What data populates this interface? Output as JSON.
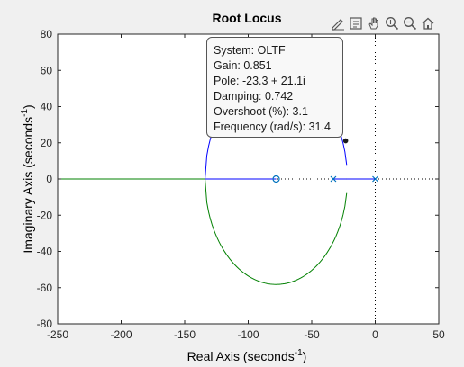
{
  "window": {
    "toolbar": [
      {
        "icon": "annotate-edit-icon"
      },
      {
        "icon": "data-tips-icon"
      },
      {
        "icon": "pan-hand-icon"
      },
      {
        "icon": "zoom-in-icon"
      },
      {
        "icon": "zoom-out-icon"
      },
      {
        "icon": "restore-home-icon"
      }
    ]
  },
  "chart_data": {
    "type": "line",
    "title": "Root Locus",
    "xlabel": "Real Axis (seconds",
    "xlabel_sup": "-1",
    "xlabel_end": ")",
    "ylabel": "Imaginary Axis (seconds",
    "ylabel_sup": "-1",
    "ylabel_end": ")",
    "xlim": [
      -250,
      50
    ],
    "ylim": [
      -80,
      80
    ],
    "xticks": [
      "-250",
      "-200",
      "-150",
      "-100",
      "-50",
      "0",
      "50"
    ],
    "yticks": [
      "80",
      "60",
      "40",
      "20",
      "0",
      "-20",
      "-40",
      "-60",
      "-80"
    ],
    "grid": false,
    "poles": [
      [
        -33,
        0
      ],
      [
        0,
        0
      ]
    ],
    "zeros": [
      [
        -78,
        0
      ]
    ],
    "breakaway_points": [
      [
        -22.5,
        0
      ],
      [
        -134,
        0
      ]
    ],
    "loop_center": [
      -78,
      0
    ],
    "loop_radius": 56,
    "series": [
      {
        "color": "#0000ff",
        "segments": [
          {
            "kind": "real",
            "x": [
              -33,
              -22.5
            ]
          },
          {
            "kind": "arc_upper",
            "from_x": -22.5,
            "to_x": -134
          }
        ]
      },
      {
        "color": "#008000",
        "segments": [
          {
            "kind": "real",
            "x": [
              -250,
              -134
            ]
          },
          {
            "kind": "arc_lower",
            "from_x": -134,
            "to_x": -22.5
          }
        ]
      },
      {
        "color": "#0000ff",
        "segments": [
          {
            "kind": "real",
            "x": [
              -22.5,
              0
            ]
          },
          {
            "kind": "real",
            "x": [
              -78,
              -134
            ]
          }
        ]
      }
    ],
    "selected_point": [
      -23.3,
      21.1
    ],
    "datatip": {
      "system": "System: OLTF",
      "gain": "Gain: 0.851",
      "pole": "Pole: -23.3 + 21.1i",
      "damping": "Damping: 0.742",
      "overshoot": "Overshoot (%): 3.1",
      "frequency": "Frequency (rad/s): 31.4"
    },
    "colors": {
      "blue": "#0000ff",
      "green": "#008000",
      "marker": "#0072bd"
    }
  }
}
